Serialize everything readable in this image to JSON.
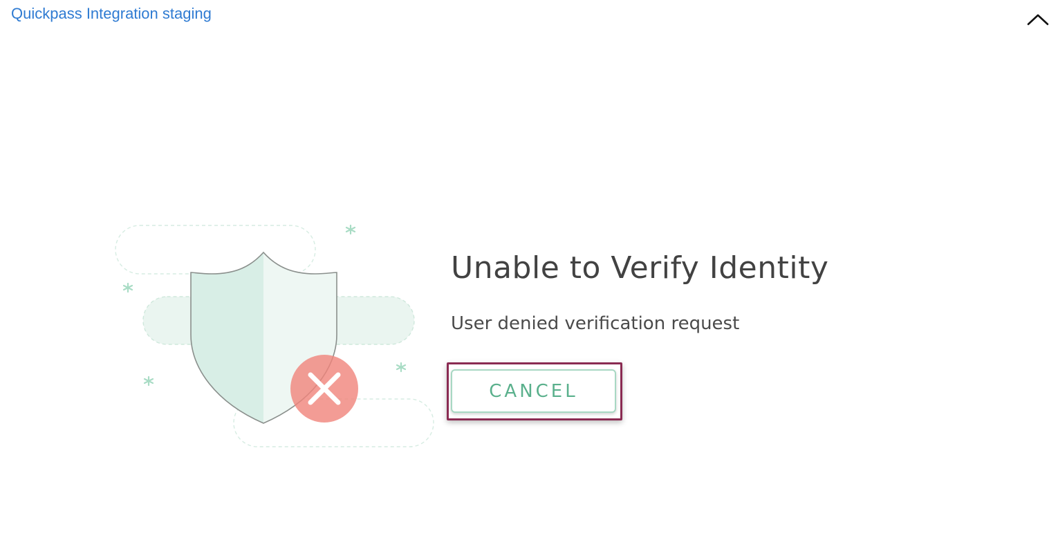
{
  "header": {
    "title": "Quickpass Integration staging",
    "collapse_icon": "chevron-up-icon"
  },
  "content": {
    "title": "Unable to Verify Identity",
    "message": "User denied verification request",
    "cancel_label": "CANCEL",
    "illustration_icon": "shield-denied-icon"
  },
  "colors": {
    "header_link": "#2f7bd2",
    "title_text": "#424242",
    "accent_green": "#5ab08c",
    "button_border": "#a8d8c3",
    "focus_frame": "#8a2b52",
    "error_badge": "#f0837a"
  }
}
